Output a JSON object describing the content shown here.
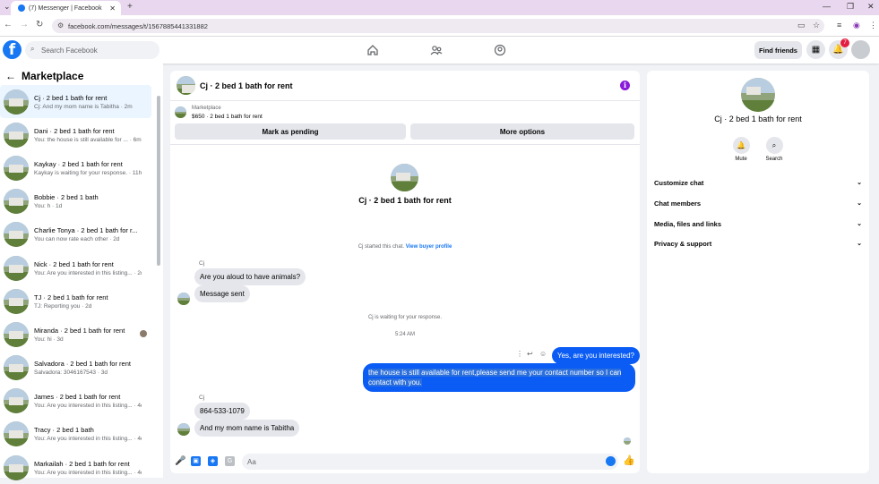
{
  "browser": {
    "tab_title": "(7) Messenger | Facebook",
    "url": "facebook.com/messages/t/1567885441331882"
  },
  "fb": {
    "search_placeholder": "Search Facebook",
    "find_friends": "Find friends",
    "notif_count": "7"
  },
  "left": {
    "title": "Marketplace",
    "conversations": [
      {
        "title": "Cj · 2 bed 1 bath for rent",
        "sub": "Cj: And my mom name is Tabitha · 2m",
        "active": true
      },
      {
        "title": "Dani · 2 bed 1 bath for rent",
        "sub": "You: the house is still available for ... · 6m"
      },
      {
        "title": "Kaykay · 2 bed 1 bath for rent",
        "sub": "Kaykay is waiting for your response. · 11h"
      },
      {
        "title": "Bobbie · 2 bed 1 bath",
        "sub": "You: h · 1d"
      },
      {
        "title": "Charlie Tonya · 2 bed 1 bath for r...",
        "sub": "You can now rate each other · 2d"
      },
      {
        "title": "Nick · 2 bed 1 bath for rent",
        "sub": "You: Are you interested in this listing... · 2d"
      },
      {
        "title": "TJ · 2 bed 1 bath for rent",
        "sub": "TJ: Reporting you · 2d"
      },
      {
        "title": "Miranda · 2 bed 1 bath for rent",
        "sub": "You: hi · 3d",
        "seen": true
      },
      {
        "title": "Salvadora · 2 bed 1 bath for rent",
        "sub": "Salvadora: 3046167543 · 3d"
      },
      {
        "title": "James · 2 bed 1 bath for rent",
        "sub": "You: Are you interested in this listing... · 4d"
      },
      {
        "title": "Tracy · 2 bed 1 bath",
        "sub": "You: Are you interested in this listing... · 4d"
      },
      {
        "title": "Markailah · 2 bed 1 bath for rent",
        "sub": "You: Are you interested in this listing... · 4d"
      }
    ]
  },
  "chat": {
    "title": "Cj · 2 bed 1 bath for rent",
    "marketplace_label": "Marketplace",
    "listing": "$650 · 2 bed 1 bath for rent",
    "mark_pending": "Mark as pending",
    "more_options": "More options",
    "big_title": "Cj · 2 bed 1 bath for rent",
    "started_text": "Cj started this chat.",
    "view_profile": "View buyer profile",
    "sender1": "Cj",
    "msg_in_1": "Are you aloud to have animals?",
    "msg_in_2": "Message sent",
    "waiting_text": "Cj is waiting for your response.",
    "time_label": "5:24 AM",
    "msg_out_1": "Yes, are you interested?",
    "msg_out_2": "the house is still available for rent,please send me your contact number so I can contact with you.",
    "sender2": "Cj",
    "msg_in_3": "864-533-1079",
    "msg_in_4": "And my mom name is Tabitha",
    "composer_placeholder": "Aa"
  },
  "right": {
    "title": "Cj · 2 bed 1 bath for rent",
    "mute": "Mute",
    "search": "Search",
    "options": [
      "Customize chat",
      "Chat members",
      "Media, files and links",
      "Privacy & support"
    ]
  }
}
